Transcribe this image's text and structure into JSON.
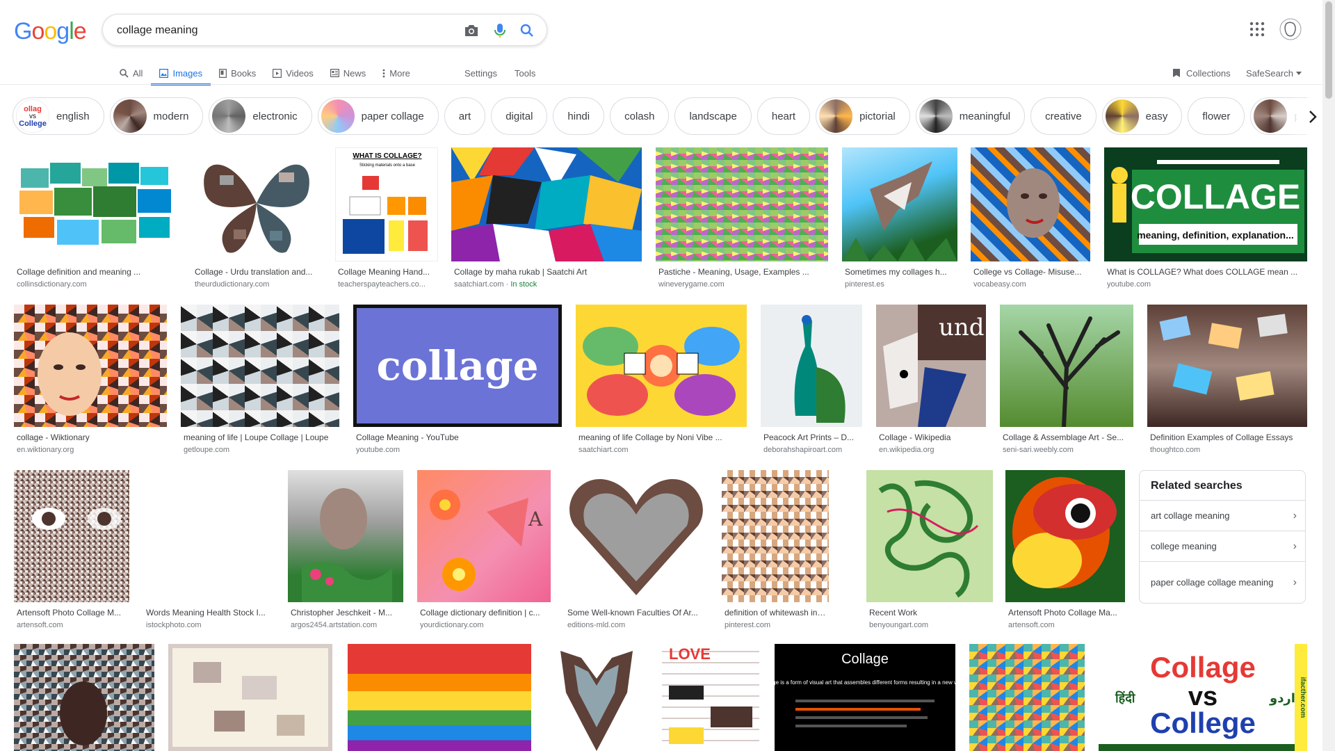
{
  "logo": {
    "letters": [
      "G",
      "o",
      "o",
      "g",
      "l",
      "e"
    ],
    "colors": [
      "#4285F4",
      "#EA4335",
      "#FBBC05",
      "#4285F4",
      "#34A853",
      "#EA4335"
    ]
  },
  "search": {
    "value": "collage meaning"
  },
  "header_icons": [
    "camera-icon",
    "mic-icon",
    "search-icon",
    "apps-icon",
    "avatar"
  ],
  "tabs": [
    {
      "label": "All",
      "icon": "search-icon"
    },
    {
      "label": "Images",
      "icon": "image-icon"
    },
    {
      "label": "Books",
      "icon": "book-icon"
    },
    {
      "label": "Videos",
      "icon": "video-icon"
    },
    {
      "label": "News",
      "icon": "news-icon"
    },
    {
      "label": "More",
      "icon": "more-dots-icon"
    }
  ],
  "tools": {
    "settings": "Settings",
    "tools": "Tools",
    "collections": "Collections",
    "safesearch": "SafeSearch"
  },
  "chips": [
    "english",
    "modern",
    "electronic",
    "paper collage",
    "art",
    "digital",
    "hindi",
    "colash",
    "landscape",
    "heart",
    "pictorial",
    "meaningful",
    "creative",
    "easy",
    "flower",
    "pers"
  ],
  "rows": [
    [
      {
        "caption": "Collage definition and meaning ...",
        "source": "collinsdictionary.com"
      },
      {
        "caption": "Collage - Urdu translation and...",
        "source": "theurdudictionary.com"
      },
      {
        "caption": "Collage Meaning Hand...",
        "source": "teacherspayteachers.co..."
      },
      {
        "caption": "Collage by maha rukab | Saatchi Art",
        "source": "saatchiart.com",
        "extra": "In stock"
      },
      {
        "caption": "Pastiche - Meaning, Usage, Examples ...",
        "source": "wineverygame.com"
      },
      {
        "caption": "Sometimes my collages h...",
        "source": "pinterest.es"
      },
      {
        "caption": "College vs Collage- Misuse...",
        "source": "vocabeasy.com"
      },
      {
        "caption": "What is COLLAGE? What does COLLAGE mean ...",
        "source": "youtube.com"
      }
    ],
    [
      {
        "caption": "collage - Wiktionary",
        "source": "en.wiktionary.org"
      },
      {
        "caption": "meaning of life | Loupe Collage | Loupe",
        "source": "getloupe.com"
      },
      {
        "caption": "Collage Meaning - YouTube",
        "source": "youtube.com"
      },
      {
        "caption": "meaning of life Collage by Noni Vibe ...",
        "source": "saatchiart.com"
      },
      {
        "caption": "Peacock Art Prints – D...",
        "source": "deborahshapiroart.com"
      },
      {
        "caption": "Collage - Wikipedia",
        "source": "en.wikipedia.org"
      },
      {
        "caption": "Collage & Assemblage Art - Se...",
        "source": "seni-sari.weebly.com"
      },
      {
        "caption": "Definition Examples of Collage Essays",
        "source": "thoughtco.com"
      }
    ],
    [
      {
        "caption": "Artensoft Photo Collage M...",
        "source": "artensoft.com"
      },
      {
        "caption": "Words Meaning Health Stock I...",
        "source": "istockphoto.com"
      },
      {
        "caption": "Christopher Jeschkeit - M...",
        "source": "argos2454.artstation.com"
      },
      {
        "caption": "Collage dictionary definition | c...",
        "source": "yourdictionary.com"
      },
      {
        "caption": "Some Well-known Faculties Of Ar...",
        "source": "editions-mld.com"
      },
      {
        "caption": "definition of whitewash in Engl...",
        "source": "pinterest.com"
      },
      {
        "caption": "Recent Work",
        "source": "benyoungart.com"
      },
      {
        "caption": "Artensoft Photo Collage Ma...",
        "source": "artensoft.com"
      }
    ]
  ],
  "thumb_text": {
    "what_is_collage": "WHAT IS COLLAGE?",
    "sticking": "Sticking materials onto a base",
    "collage_big": "COLLAGE",
    "collage_sub": "meaning, definition, explanation...",
    "collage_word": "collage",
    "und": "und",
    "collage_title": "Collage",
    "collage_body": "Collage is a form of visual art that assembles different forms resulting in a new whole.",
    "cvc_1": "Collage",
    "cvc_vs": "vs",
    "cvc_2": "College",
    "hindi": "हिंदी",
    "urdu": "اردو",
    "site": "ifacther.com",
    "chip_c1": "ollag",
    "chip_c2": "vs",
    "chip_c3": "College"
  },
  "related": {
    "title": "Related searches",
    "items": [
      "art collage meaning",
      "college meaning",
      "paper collage collage meaning"
    ]
  },
  "colors": {
    "accent": "#1a73e8",
    "instock": "#188038"
  }
}
